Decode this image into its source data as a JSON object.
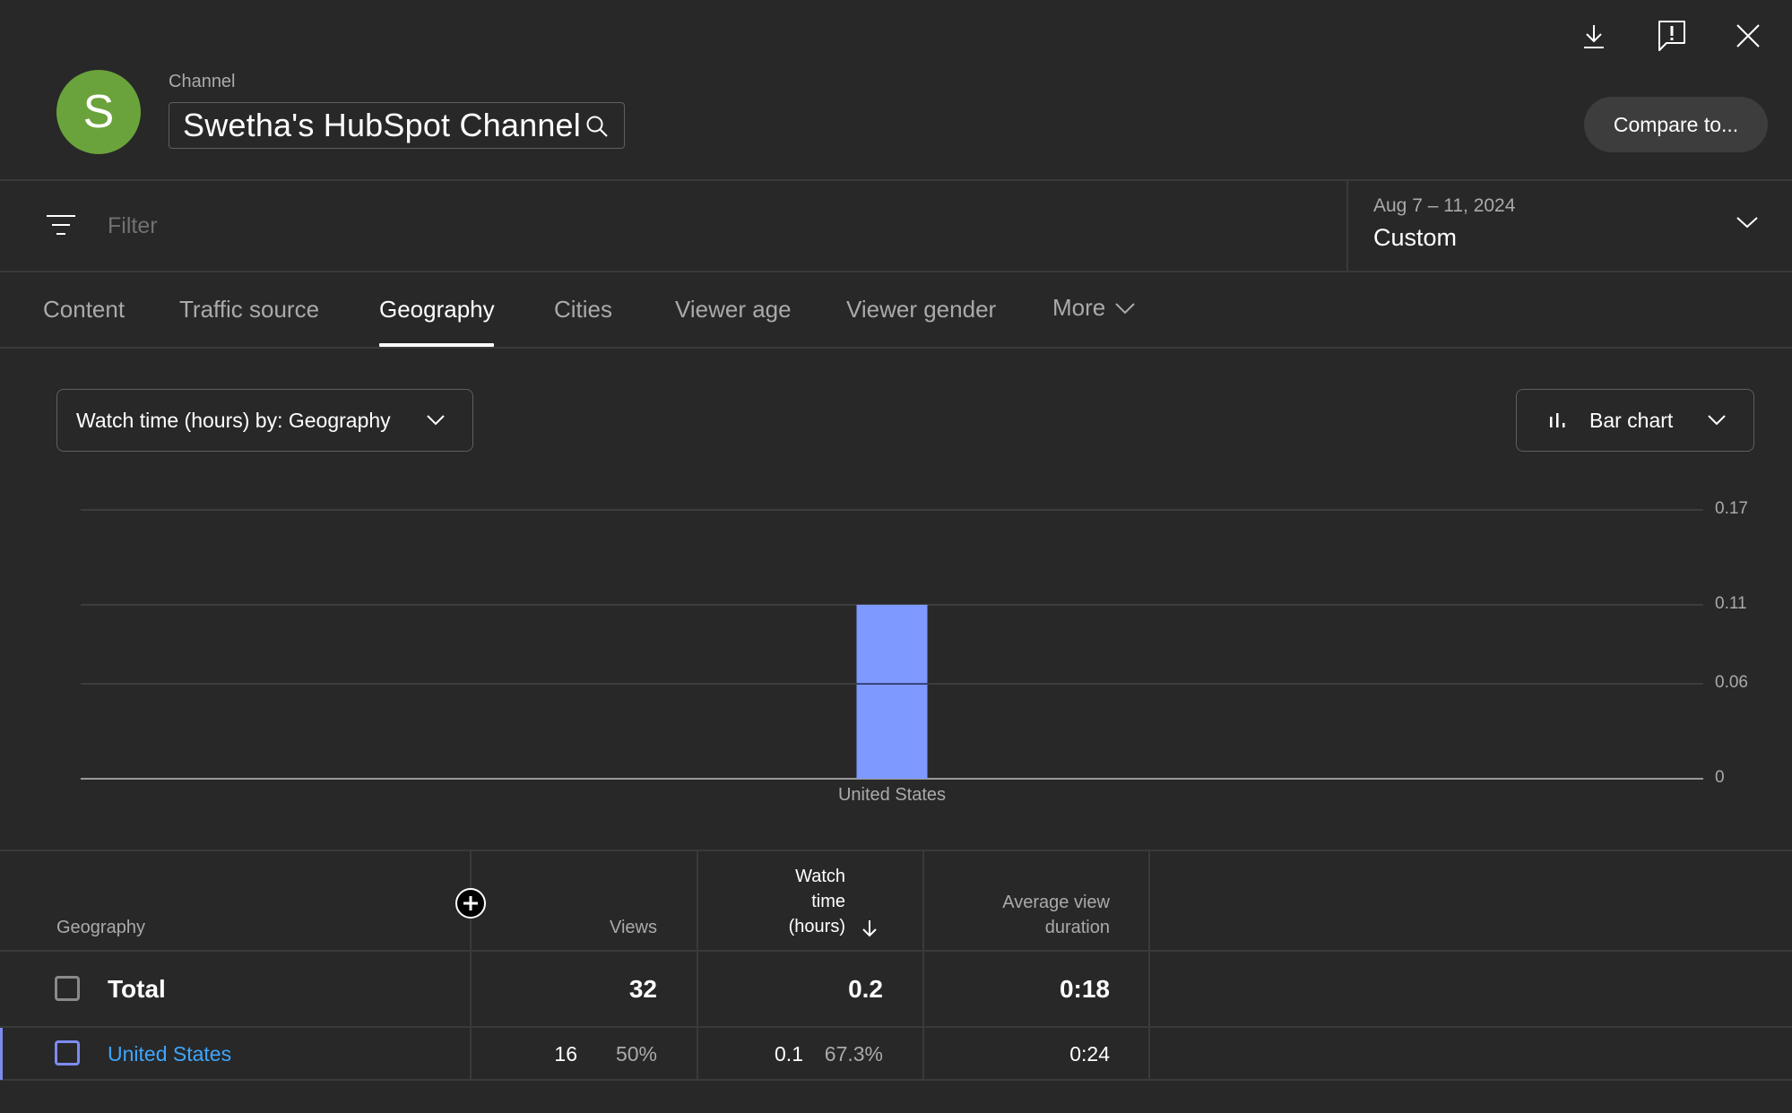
{
  "header": {
    "avatar_letter": "S",
    "avatar_color": "#6aa33b",
    "channel_label": "Channel",
    "channel_name": "Swetha's HubSpot Channel",
    "icons": [
      "download-icon",
      "feedback-icon",
      "close-icon"
    ],
    "compare_button": "Compare to..."
  },
  "filter": {
    "placeholder": "Filter",
    "date_range": "Aug 7 – 11, 2024",
    "date_preset": "Custom"
  },
  "tabs": [
    {
      "label": "Content",
      "active": false
    },
    {
      "label": "Traffic source",
      "active": false
    },
    {
      "label": "Geography",
      "active": true
    },
    {
      "label": "Cities",
      "active": false
    },
    {
      "label": "Viewer age",
      "active": false
    },
    {
      "label": "Viewer gender",
      "active": false
    },
    {
      "label": "More",
      "active": false
    }
  ],
  "controls": {
    "metric_select": "Watch time (hours) by: Geography",
    "chart_type_select": "Bar chart"
  },
  "chart_data": {
    "type": "bar",
    "title": "Watch time (hours) by: Geography",
    "categories": [
      "United States"
    ],
    "values": [
      0.11
    ],
    "xlabel": "",
    "ylabel": "Watch time (hours)",
    "ylim": [
      0,
      0.17
    ],
    "yticks": [
      0,
      0.06,
      0.11,
      0.17
    ],
    "ytick_labels": [
      "0",
      "0.06",
      "0.11",
      "0.17"
    ],
    "grid": true,
    "bar_color": "#7e99ff",
    "y_axis_side": "right"
  },
  "table": {
    "columns": {
      "geography": "Geography",
      "views": "Views",
      "watch_time": [
        "Watch",
        "time",
        "(hours)"
      ],
      "avg_duration": [
        "Average view",
        "duration"
      ]
    },
    "sort": "watch_time-descending",
    "total": {
      "label": "Total",
      "views": "32",
      "watch_time": "0.2",
      "avg_duration": "0:18"
    },
    "rows": [
      {
        "label": "United States",
        "views": "16",
        "views_pct": "50%",
        "watch_time": "0.1",
        "watch_time_pct": "67.3%",
        "avg_duration": "0:24",
        "color": "#7d8cf0"
      }
    ]
  }
}
